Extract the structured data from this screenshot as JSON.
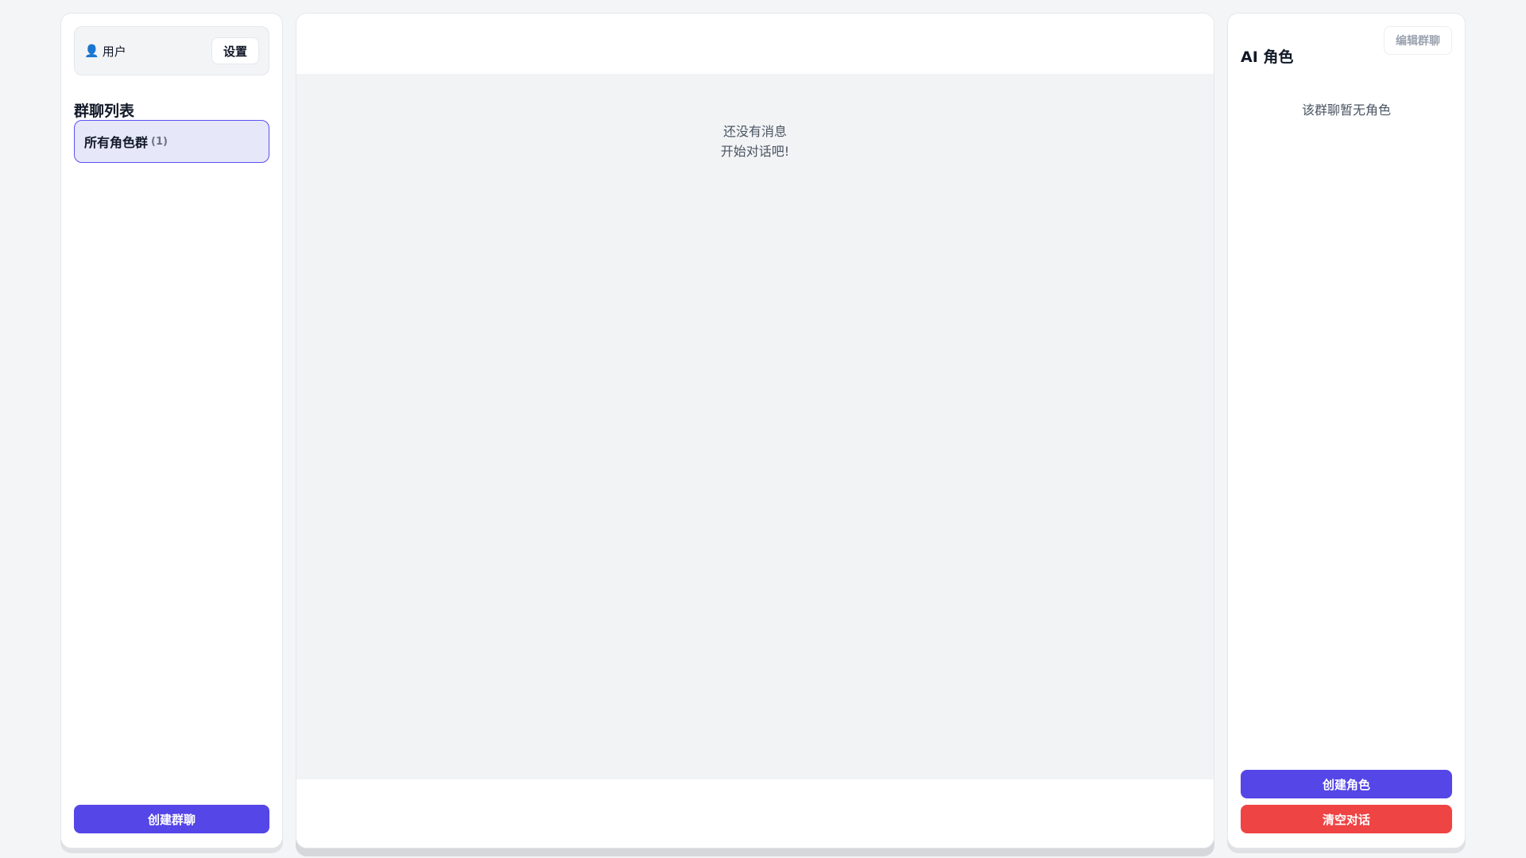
{
  "colors": {
    "accent": "#5546e8",
    "danger": "#ef4444",
    "selected_bg": "#e6e7f8",
    "background": "#f4f5f7"
  },
  "sidebar": {
    "user_icon": "user-icon",
    "user_label": "用户",
    "settings_label": "设置",
    "section_title": "群聊列表",
    "groups": [
      {
        "name": "所有角色群",
        "count": "(1)",
        "selected": true
      }
    ],
    "create_group_label": "创建群聊"
  },
  "chat": {
    "empty_line1": "还没有消息",
    "empty_line2": "开始对话吧!"
  },
  "roles": {
    "title": "AI 角色",
    "edit_group_label": "编辑群聊",
    "empty_text": "该群聊暂无角色",
    "create_role_label": "创建角色",
    "clear_chat_label": "清空对话"
  }
}
